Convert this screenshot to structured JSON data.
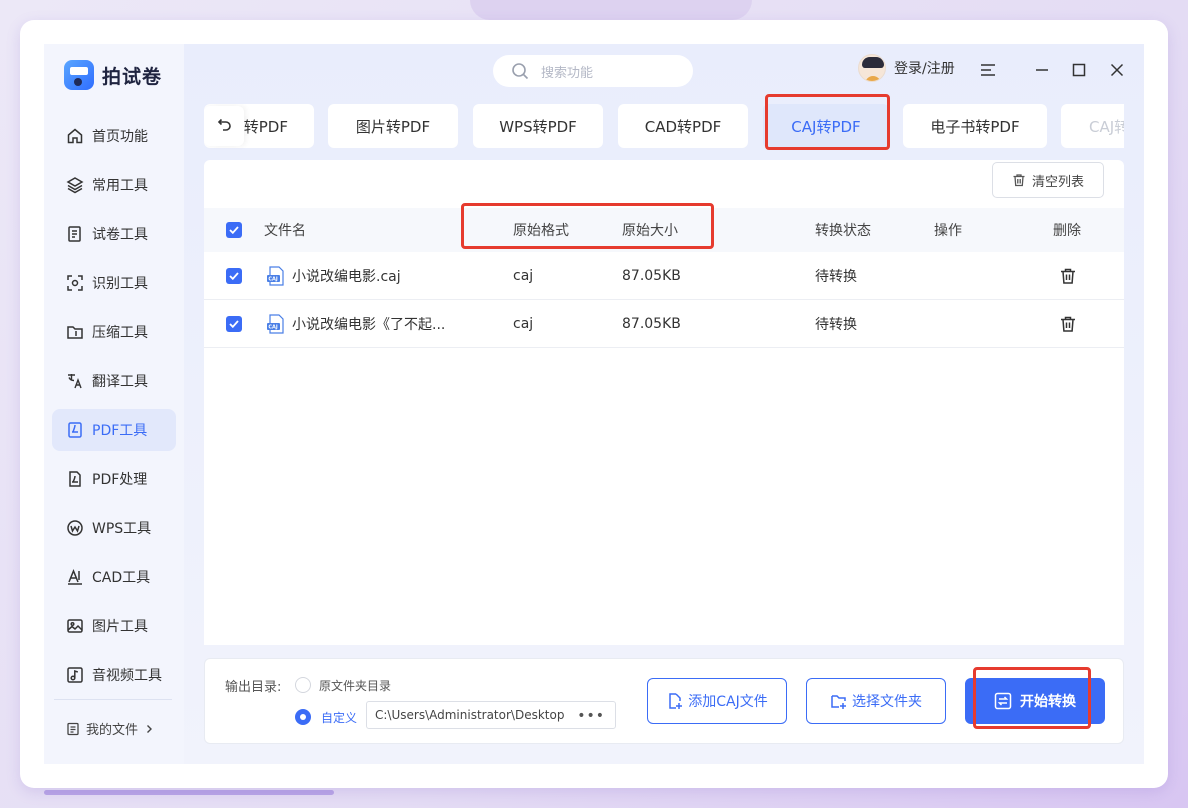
{
  "app": {
    "name": "拍试卷"
  },
  "search": {
    "placeholder": "搜索功能"
  },
  "user": {
    "login_label": "登录/注册"
  },
  "sidebar": {
    "items": [
      {
        "label": "首页功能"
      },
      {
        "label": "常用工具"
      },
      {
        "label": "试卷工具"
      },
      {
        "label": "识别工具"
      },
      {
        "label": "压缩工具"
      },
      {
        "label": "翻译工具"
      },
      {
        "label": "PDF工具",
        "active": true
      },
      {
        "label": "PDF处理"
      },
      {
        "label": "WPS工具"
      },
      {
        "label": "CAD工具"
      },
      {
        "label": "图片工具"
      },
      {
        "label": "音视频工具"
      }
    ],
    "my_files": "我的文件"
  },
  "tabs": [
    {
      "label": "转PDF"
    },
    {
      "label": "图片转PDF"
    },
    {
      "label": "WPS转PDF"
    },
    {
      "label": "CAD转PDF"
    },
    {
      "label": "CAJ转PDF",
      "active": true
    },
    {
      "label": "电子书转PDF"
    },
    {
      "label": "CAJ转"
    }
  ],
  "toolbar": {
    "clear_label": "清空列表"
  },
  "table": {
    "headers": {
      "name": "文件名",
      "format": "原始格式",
      "size": "原始大小",
      "status": "转换状态",
      "action": "操作",
      "delete": "删除"
    },
    "rows": [
      {
        "name": "小说改编电影.caj",
        "format": "caj",
        "size": "87.05KB",
        "status": "待转换",
        "checked": true
      },
      {
        "name": "小说改编电影《了不起...",
        "format": "caj",
        "size": "87.05KB",
        "status": "待转换",
        "checked": true
      }
    ]
  },
  "footer": {
    "output_label": "输出目录:",
    "option_original": "原文件夹目录",
    "option_custom": "自定义",
    "selected_option": "自定义",
    "custom_path": "C:\\Users\\Administrator\\Desktop",
    "add_button": "添加CAJ文件",
    "folder_button": "选择文件夹",
    "start_button": "开始转换"
  },
  "colors": {
    "accent": "#3b6cf6",
    "highlight": "#e63b2e",
    "sidebar_active_bg": "#e2e8fb"
  }
}
